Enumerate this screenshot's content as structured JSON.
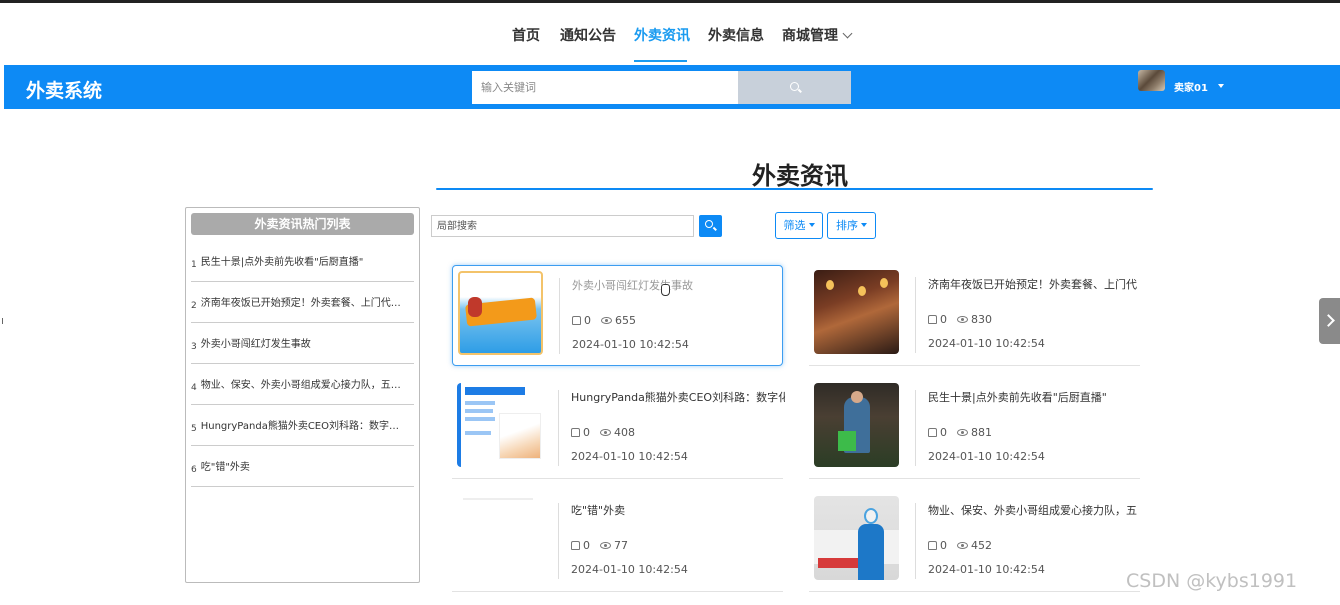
{
  "topnav": {
    "items": [
      "首页",
      "通知公告",
      "外卖资讯",
      "外卖信息",
      "商城管理"
    ],
    "active": "外卖资讯"
  },
  "header": {
    "brand": "外卖系统",
    "search_placeholder": "输入关键词",
    "username": "卖家01",
    "accent_color": "#0d8af5"
  },
  "page": {
    "title": "外卖资讯"
  },
  "sidebar": {
    "heading": "外卖资讯热门列表",
    "items": [
      {
        "num": "1",
        "title": "民生十景|点外卖前先收看\"后厨直播\""
      },
      {
        "num": "2",
        "title": "济南年夜饭已开始预定！外卖套餐、上门代…"
      },
      {
        "num": "3",
        "title": "外卖小哥闯红灯发生事故"
      },
      {
        "num": "4",
        "title": "物业、保安、外卖小哥组成爱心接力队，五…"
      },
      {
        "num": "5",
        "title": "HungryPanda熊猫外卖CEO刘科路：数字…"
      },
      {
        "num": "6",
        "title": "吃\"错\"外卖"
      }
    ]
  },
  "toolbar": {
    "local_search_placeholder": "局部搜索",
    "filter_label": "筛选",
    "sort_label": "排序"
  },
  "cards": [
    {
      "title": "外卖小哥闯红灯发生事故",
      "likes": "0",
      "views": "655",
      "date": "2024-01-10 10:42:54",
      "thumb": "takeaway-logo-image"
    },
    {
      "title": "济南年夜饭已开始预定！外卖套餐、上门代",
      "likes": "0",
      "views": "830",
      "date": "2024-01-10 10:42:54",
      "thumb": "restaurant-image"
    },
    {
      "title": "HungryPanda熊猫外卖CEO刘科路：数字化",
      "likes": "0",
      "views": "408",
      "date": "2024-01-10 10:42:54",
      "thumb": "document-image"
    },
    {
      "title": "民生十景|点外卖前先收看\"后厨直播\"",
      "likes": "0",
      "views": "881",
      "date": "2024-01-10 10:42:54",
      "thumb": "worker-image"
    },
    {
      "title": "吃\"错\"外卖",
      "likes": "0",
      "views": "77",
      "date": "2024-01-10 10:42:54",
      "thumb": "blank-image"
    },
    {
      "title": "物业、保安、外卖小哥组成爱心接力队，五",
      "likes": "0",
      "views": "452",
      "date": "2024-01-10 10:42:54",
      "thumb": "courier-image"
    }
  ],
  "watermark": "CSDN @kybs1991"
}
